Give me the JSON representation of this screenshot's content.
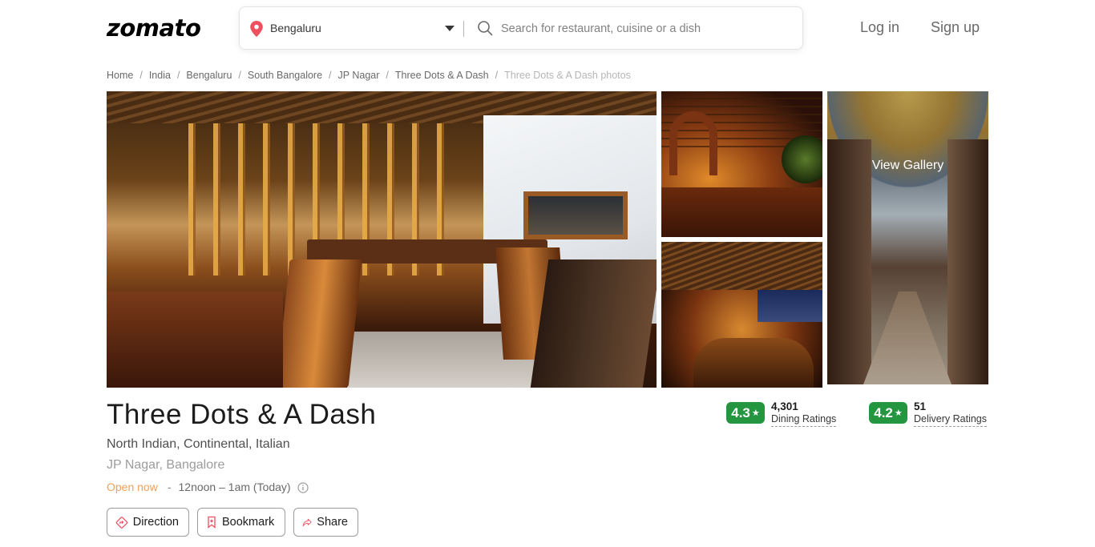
{
  "header": {
    "logo": "zomato",
    "location": "Bengaluru",
    "search_placeholder": "Search for restaurant, cuisine or a dish",
    "login": "Log in",
    "signup": "Sign up",
    "icons": {
      "location": "location-pin-icon",
      "caret": "caret-down-icon",
      "search": "search-icon"
    }
  },
  "breadcrumb": {
    "items": [
      "Home",
      "India",
      "Bengaluru",
      "South Bangalore",
      "JP Nagar",
      "Three Dots & A Dash"
    ],
    "current": "Three Dots & A Dash photos",
    "separator": "/"
  },
  "gallery": {
    "view_gallery": "View Gallery"
  },
  "restaurant": {
    "name": "Three Dots & A Dash",
    "cuisines": "North Indian, Continental, Italian",
    "locality": "JP Nagar, Bangalore",
    "status": "Open now",
    "timing_separator": "-",
    "timing": "12noon – 1am (Today)"
  },
  "actions": {
    "direction": "Direction",
    "bookmark": "Bookmark",
    "share": "Share"
  },
  "ratings": {
    "dining": {
      "value": "4.3",
      "count": "4,301",
      "label": "Dining Ratings"
    },
    "delivery": {
      "value": "4.2",
      "count": "51",
      "label": "Delivery Ratings"
    }
  },
  "colors": {
    "rating_green": "#24963f",
    "open_now": "#f0a15b",
    "pin_red": "#ef4f5f"
  }
}
